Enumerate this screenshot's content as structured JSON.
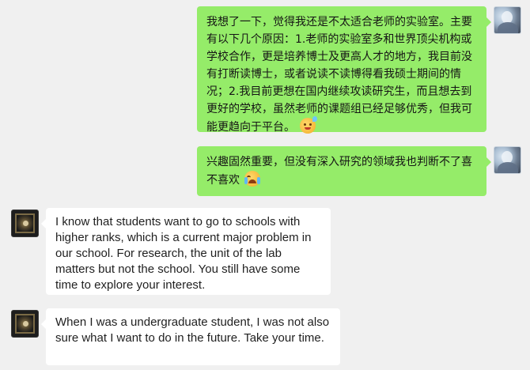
{
  "messages": [
    {
      "sender": "self",
      "text": "我想了一下，觉得我还是不太适合老师的实验室。主要有以下几个原因：1.老师的实验室多和世界顶尖机构或学校合作，更是培养博士及更高人才的地方，我目前没有打断读博士，或者说读不读博得看我硕士期间的情况；2.我目前更想在国内继续攻读研究生，而且想去到更好的学校，虽然老师的课题组已经足够优秀，但我可能更趋向于平台。",
      "emoji": "sweat-smile-emoji"
    },
    {
      "sender": "self",
      "text": "兴趣固然重要，但没有深入研究的领域我也判断不了喜不喜欢",
      "emoji": "crying-emoji"
    },
    {
      "sender": "other",
      "text": "I know that students want to go to schools with higher ranks, which is a current major problem in our school. For research, the unit of the lab matters but not the school. You still have some time to explore your interest."
    },
    {
      "sender": "other",
      "text": "When I was a undergraduate student, I was not also sure what I want to do in the future. Take your time."
    }
  ],
  "colors": {
    "background": "#f0f0f0",
    "self_bubble": "#95ec69",
    "other_bubble": "#ffffff"
  }
}
